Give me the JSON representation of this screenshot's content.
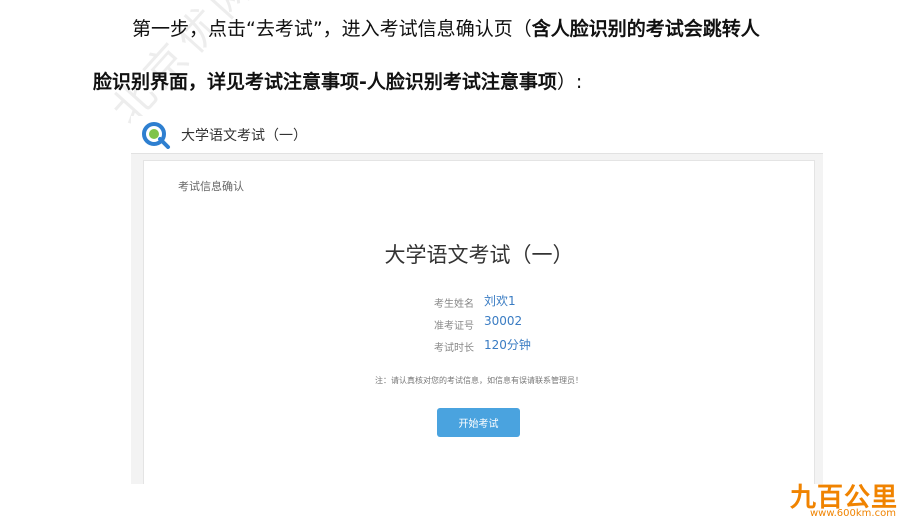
{
  "doc": {
    "line1_plain": "第一步，点击“去考试”，进入考试信息确认页（",
    "line1_bold": "含人脸识别的考试会跳转人",
    "line2_bold": "脸识别界面，详见考试注意事项-人脸识别考试注意事项",
    "line2_tail": "）:",
    "watermark": "北京优网"
  },
  "app": {
    "title": "大学语文考试（一）",
    "logo_icon": "q-logo-icon",
    "accent_color": "#4aa3df"
  },
  "card": {
    "caption": "考试信息确认",
    "exam_title": "大学语文考试（一）",
    "rows": [
      {
        "label": "考生姓名",
        "value": "刘欢1"
      },
      {
        "label": "准考证号",
        "value": "30002"
      },
      {
        "label": "考试时长",
        "value": "120分钟"
      }
    ],
    "notice": "注：请认真核对您的考试信息，如信息有误请联系管理员！",
    "start_button": "开始考试"
  },
  "brand": {
    "name": "九百公里",
    "url": "www.600km.com",
    "color": "#f08300"
  }
}
